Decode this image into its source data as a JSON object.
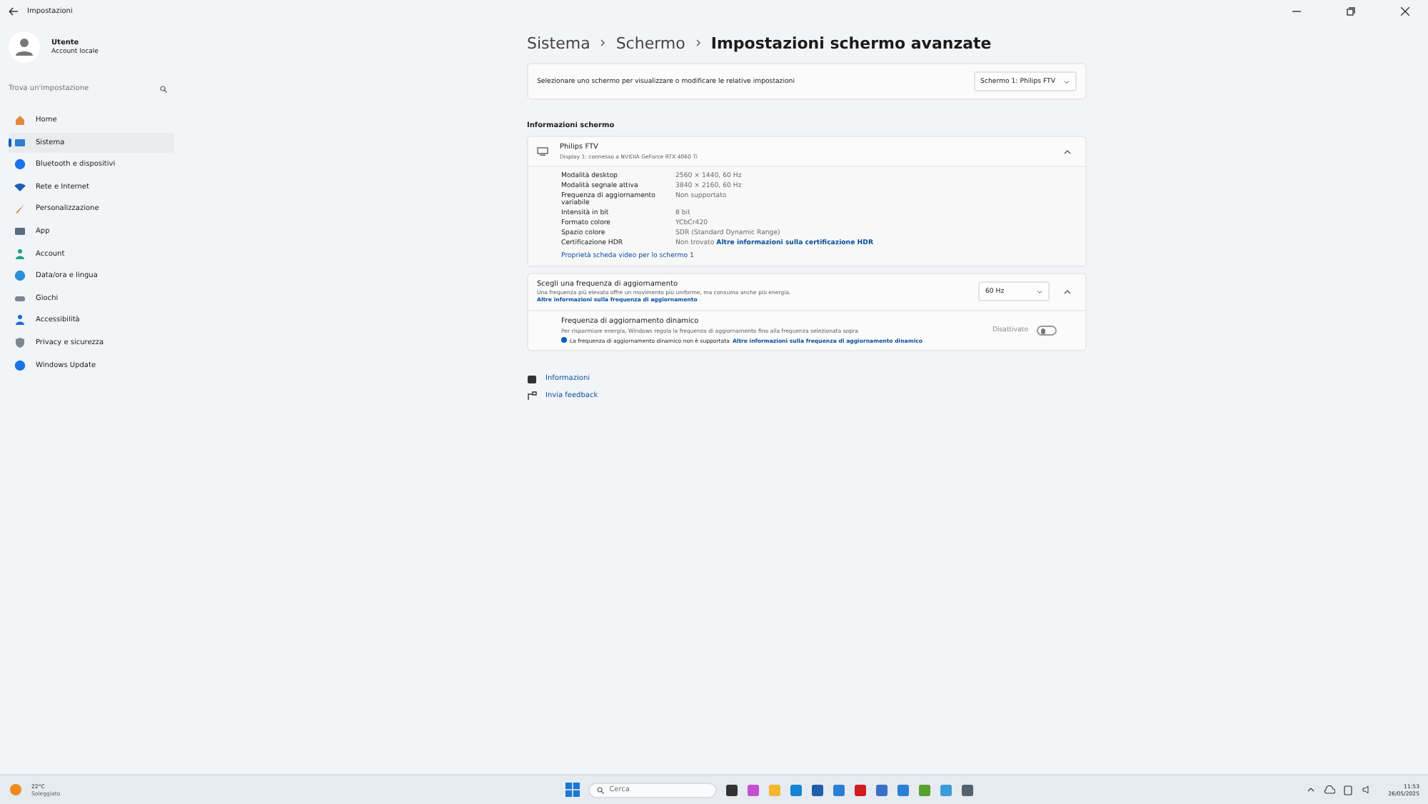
{
  "window": {
    "title": "Impostazioni"
  },
  "user": {
    "name": "Utente",
    "subtitle": "Account locale"
  },
  "search": {
    "placeholder": "Trova un'impostazione"
  },
  "sidebar": {
    "items": [
      {
        "label": "Home",
        "selected": false
      },
      {
        "label": "Sistema",
        "selected": true
      },
      {
        "label": "Bluetooth e dispositivi",
        "selected": false
      },
      {
        "label": "Rete e Internet",
        "selected": false
      },
      {
        "label": "Personalizzazione",
        "selected": false
      },
      {
        "label": "App",
        "selected": false
      },
      {
        "label": "Account",
        "selected": false
      },
      {
        "label": "Data/ora e lingua",
        "selected": false
      },
      {
        "label": "Giochi",
        "selected": false
      },
      {
        "label": "Accessibilità",
        "selected": false
      },
      {
        "label": "Privacy e sicurezza",
        "selected": false
      },
      {
        "label": "Windows Update",
        "selected": false
      }
    ]
  },
  "breadcrumb": [
    "Sistema",
    "Schermo",
    "Impostazioni schermo avanzate"
  ],
  "display_select": {
    "label": "Selezionare uno schermo per visualizzare o modificare le relative impostazioni",
    "value": "Schermo 1: Philips FTV"
  },
  "section_title": "Informazioni schermo",
  "display_info": {
    "name": "Philips FTV",
    "subtitle": "Display 1: connesso a NVIDIA GeForce RTX 4060 Ti",
    "expanded": true,
    "rows": [
      {
        "label": "Modalità desktop",
        "value": "2560 × 1440, 60 Hz"
      },
      {
        "label": "Modalità segnale attiva",
        "value": "3840 × 2160, 60 Hz"
      },
      {
        "label": "Frequenza di aggiornamento variabile",
        "value": "Non supportato"
      },
      {
        "label": "Intensità in bit",
        "value": "8 bit"
      },
      {
        "label": "Formato colore",
        "value": "YCbCr420"
      },
      {
        "label": "Spazio colore",
        "value": "SDR (Standard Dynamic Range)"
      },
      {
        "label": "Certificazione HDR",
        "value": "Non trovato",
        "link": "Altre informazioni sulla certificazione HDR"
      }
    ],
    "link": "Proprietà scheda video per lo schermo 1"
  },
  "refresh": {
    "title": "Scegli una frequenza di aggiornamento",
    "description": "Una frequenza più elevata offre un movimento più uniforme, ma consuma anche più energia.",
    "link": "Altre informazioni sulla frequenza di aggiornamento",
    "value": "60 Hz",
    "expanded": true,
    "dynamic": {
      "title": "Frequenza di aggiornamento dinamico",
      "description": "Per risparmiare energia, Windows regola la frequenza di aggiornamento fino alla frequenza selezionata sopra",
      "note": "La frequenza di aggiornamento dinamico non è supportata",
      "link": "Altre informazioni sulla frequenza di aggiornamento dinamico",
      "toggle_label": "Disattivato",
      "on": false
    }
  },
  "footer_links": [
    {
      "label": "Informazioni"
    },
    {
      "label": "Invia feedback"
    }
  ],
  "taskbar": {
    "weather": {
      "temp": "22°C",
      "condition": "Soleggiato"
    },
    "search_placeholder": "Cerca",
    "time": "11:53",
    "date": "26/05/2025"
  }
}
